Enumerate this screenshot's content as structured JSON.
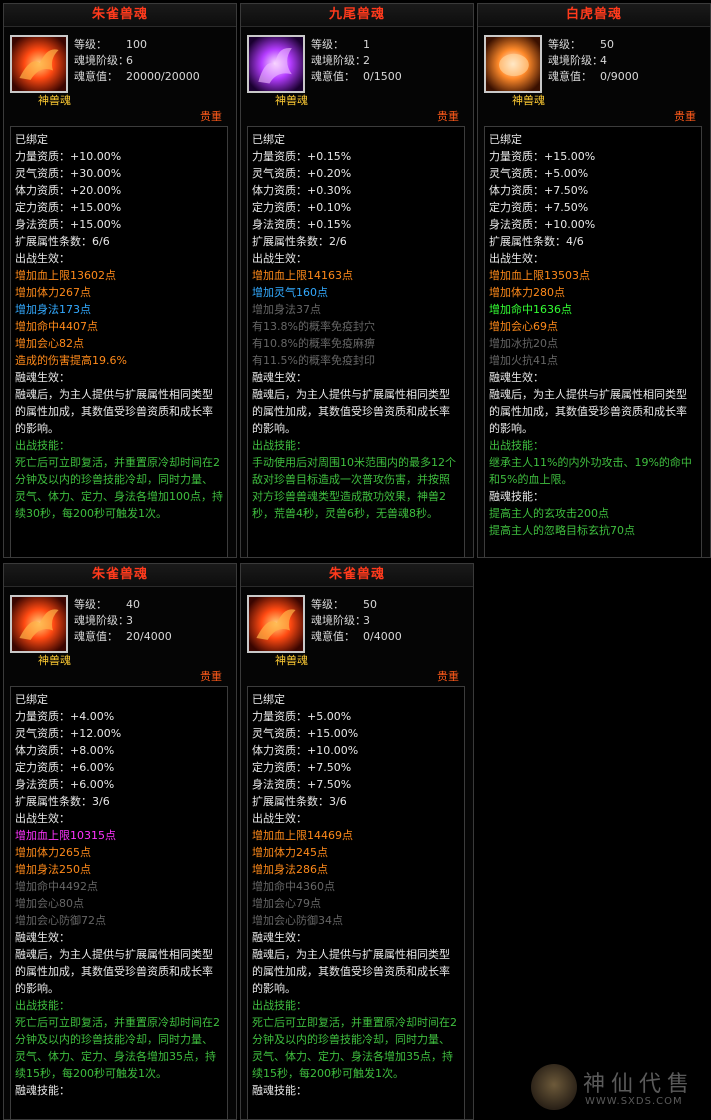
{
  "panels": [
    {
      "id": "p1",
      "title": "朱雀兽魂",
      "icon": "zhuque-icon",
      "stats": {
        "level_label": "等级：",
        "level": "100",
        "realm_label": "魂境阶级：",
        "realm": "6",
        "will_label": "魂意值：",
        "will": "20000/20000"
      },
      "kind": "神兽魂",
      "rarity": "贵重",
      "lines": [
        {
          "t": "已绑定",
          "c": "white"
        },
        {
          "t": "力量资质：+10.00%",
          "c": "white"
        },
        {
          "t": "灵气资质：+30.00%",
          "c": "white"
        },
        {
          "t": "体力资质：+20.00%",
          "c": "white"
        },
        {
          "t": "定力资质：+15.00%",
          "c": "white"
        },
        {
          "t": "身法资质：+15.00%",
          "c": "white"
        },
        {
          "t": "扩展属性条数：6/6",
          "c": "white"
        },
        {
          "t": "出战生效：",
          "c": "white"
        },
        {
          "t": "增加血上限13602点",
          "c": "orange"
        },
        {
          "t": "增加体力267点",
          "c": "orange"
        },
        {
          "t": "增加身法173点",
          "c": "blue"
        },
        {
          "t": "增加命中4407点",
          "c": "orange"
        },
        {
          "t": "增加会心82点",
          "c": "orange"
        },
        {
          "t": "造成的伤害提高19.6%",
          "c": "orange"
        },
        {
          "t": "融魂生效：",
          "c": "white"
        },
        {
          "t": "融魂后，为主人提供与扩展属性相同类型的属性加成，其数值受珍兽资质和成长率的影响。",
          "c": "white",
          "wrap": true
        },
        {
          "t": "出战技能：",
          "c": "darkgreen"
        },
        {
          "t": "死亡后可立即复活，并重置原冷却时间在2分钟及以内的珍兽技能冷却，同时力量、灵气、体力、定力、身法各增加100点，持续30秒，每200秒可触发1次。",
          "c": "darkgreen",
          "wrap": true
        }
      ]
    },
    {
      "id": "p2",
      "title": "九尾兽魂",
      "icon": "jiuwei-icon",
      "stats": {
        "level_label": "等级：",
        "level": "1",
        "realm_label": "魂境阶级：",
        "realm": "2",
        "will_label": "魂意值：",
        "will": "0/1500"
      },
      "kind": "神兽魂",
      "rarity": "贵重",
      "lines": [
        {
          "t": "已绑定",
          "c": "white"
        },
        {
          "t": "力量资质：+0.15%",
          "c": "white"
        },
        {
          "t": "灵气资质：+0.20%",
          "c": "white"
        },
        {
          "t": "体力资质：+0.30%",
          "c": "white"
        },
        {
          "t": "定力资质：+0.10%",
          "c": "white"
        },
        {
          "t": "身法资质：+0.15%",
          "c": "white"
        },
        {
          "t": "扩展属性条数：2/6",
          "c": "white"
        },
        {
          "t": "出战生效：",
          "c": "white"
        },
        {
          "t": "增加血上限14163点",
          "c": "orange"
        },
        {
          "t": "增加灵气160点",
          "c": "blue"
        },
        {
          "t": "增加身法37点",
          "c": "gray"
        },
        {
          "t": "有13.8%的概率免疫封穴",
          "c": "gray"
        },
        {
          "t": "有10.8%的概率免疫麻痹",
          "c": "gray"
        },
        {
          "t": "有11.5%的概率免疫封印",
          "c": "gray"
        },
        {
          "t": "融魂生效：",
          "c": "white"
        },
        {
          "t": "融魂后，为主人提供与扩展属性相同类型的属性加成，其数值受珍兽资质和成长率的影响。",
          "c": "white",
          "wrap": true
        },
        {
          "t": "出战技能：",
          "c": "darkgreen"
        },
        {
          "t": "手动使用后对周围10米范围内的最多12个敌对珍兽目标造成一次普攻伤害，并按照对方珍兽兽魂类型造成散功效果，神兽2秒，荒兽4秒，灵兽6秒，无兽魂8秒。",
          "c": "darkgreen",
          "wrap": true
        }
      ]
    },
    {
      "id": "p3",
      "title": "白虎兽魂",
      "icon": "baihu-icon",
      "stats": {
        "level_label": "等级：",
        "level": "50",
        "realm_label": "魂境阶级：",
        "realm": "4",
        "will_label": "魂意值：",
        "will": "0/9000"
      },
      "kind": "神兽魂",
      "rarity": "贵重",
      "lines": [
        {
          "t": "已绑定",
          "c": "white"
        },
        {
          "t": "力量资质：+15.00%",
          "c": "white"
        },
        {
          "t": "灵气资质：+5.00%",
          "c": "white"
        },
        {
          "t": "体力资质：+7.50%",
          "c": "white"
        },
        {
          "t": "定力资质：+7.50%",
          "c": "white"
        },
        {
          "t": "身法资质：+10.00%",
          "c": "white"
        },
        {
          "t": "扩展属性条数：4/6",
          "c": "white"
        },
        {
          "t": "出战生效：",
          "c": "white"
        },
        {
          "t": "增加血上限13503点",
          "c": "orange"
        },
        {
          "t": "增加体力280点",
          "c": "orange"
        },
        {
          "t": "增加命中1636点",
          "c": "green"
        },
        {
          "t": "增加会心69点",
          "c": "orange"
        },
        {
          "t": "增加冰抗20点",
          "c": "gray"
        },
        {
          "t": "增加火抗41点",
          "c": "gray"
        },
        {
          "t": "融魂生效：",
          "c": "white"
        },
        {
          "t": "融魂后，为主人提供与扩展属性相同类型的属性加成，其数值受珍兽资质和成长率的影响。",
          "c": "white",
          "wrap": true
        },
        {
          "t": "出战技能：",
          "c": "darkgreen"
        },
        {
          "t": "继承主人11%的内外功攻击、19%的命中和5%的血上限。",
          "c": "darkgreen",
          "wrap": true
        },
        {
          "t": "融魂技能：",
          "c": "white"
        },
        {
          "t": "提高主人的玄攻击200点",
          "c": "darkgreen"
        },
        {
          "t": "提高主人的忽略目标玄抗70点",
          "c": "darkgreen"
        }
      ]
    },
    {
      "id": "p4",
      "title": "朱雀兽魂",
      "icon": "zhuque-icon",
      "stats": {
        "level_label": "等级：",
        "level": "40",
        "realm_label": "魂境阶级：",
        "realm": "3",
        "will_label": "魂意值：",
        "will": "20/4000"
      },
      "kind": "神兽魂",
      "rarity": "贵重",
      "lines": [
        {
          "t": "已绑定",
          "c": "white"
        },
        {
          "t": "力量资质：+4.00%",
          "c": "white"
        },
        {
          "t": "灵气资质：+12.00%",
          "c": "white"
        },
        {
          "t": "体力资质：+8.00%",
          "c": "white"
        },
        {
          "t": "定力资质：+6.00%",
          "c": "white"
        },
        {
          "t": "身法资质：+6.00%",
          "c": "white"
        },
        {
          "t": "扩展属性条数：3/6",
          "c": "white"
        },
        {
          "t": "出战生效：",
          "c": "white"
        },
        {
          "t": "增加血上限10315点",
          "c": "magenta"
        },
        {
          "t": "增加体力265点",
          "c": "orange"
        },
        {
          "t": "增加身法250点",
          "c": "orange"
        },
        {
          "t": "增加命中4492点",
          "c": "gray"
        },
        {
          "t": "增加会心80点",
          "c": "gray"
        },
        {
          "t": "增加会心防御72点",
          "c": "gray"
        },
        {
          "t": "融魂生效：",
          "c": "white"
        },
        {
          "t": "融魂后，为主人提供与扩展属性相同类型的属性加成，其数值受珍兽资质和成长率的影响。",
          "c": "white",
          "wrap": true
        },
        {
          "t": "出战技能：",
          "c": "darkgreen"
        },
        {
          "t": "死亡后可立即复活，并重置原冷却时间在2分钟及以内的珍兽技能冷却，同时力量、灵气、体力、定力、身法各增加35点，持续15秒，每200秒可触发1次。",
          "c": "darkgreen",
          "wrap": true
        },
        {
          "t": "融魂技能：",
          "c": "white"
        }
      ]
    },
    {
      "id": "p5",
      "title": "朱雀兽魂",
      "icon": "zhuque-icon",
      "stats": {
        "level_label": "等级：",
        "level": "50",
        "realm_label": "魂境阶级：",
        "realm": "3",
        "will_label": "魂意值：",
        "will": "0/4000"
      },
      "kind": "神兽魂",
      "rarity": "贵重",
      "lines": [
        {
          "t": "已绑定",
          "c": "white"
        },
        {
          "t": "力量资质：+5.00%",
          "c": "white"
        },
        {
          "t": "灵气资质：+15.00%",
          "c": "white"
        },
        {
          "t": "体力资质：+10.00%",
          "c": "white"
        },
        {
          "t": "定力资质：+7.50%",
          "c": "white"
        },
        {
          "t": "身法资质：+7.50%",
          "c": "white"
        },
        {
          "t": "扩展属性条数：3/6",
          "c": "white"
        },
        {
          "t": "出战生效：",
          "c": "white"
        },
        {
          "t": "增加血上限14469点",
          "c": "orange"
        },
        {
          "t": "增加体力245点",
          "c": "orange"
        },
        {
          "t": "增加身法286点",
          "c": "orange"
        },
        {
          "t": "增加命中4360点",
          "c": "gray"
        },
        {
          "t": "增加会心79点",
          "c": "gray"
        },
        {
          "t": "增加会心防御34点",
          "c": "gray"
        },
        {
          "t": "融魂生效：",
          "c": "white"
        },
        {
          "t": "融魂后，为主人提供与扩展属性相同类型的属性加成，其数值受珍兽资质和成长率的影响。",
          "c": "white",
          "wrap": true
        },
        {
          "t": "出战技能：",
          "c": "darkgreen"
        },
        {
          "t": "死亡后可立即复活，并重置原冷却时间在2分钟及以内的珍兽技能冷却，同时力量、灵气、体力、定力、身法各增加35点，持续15秒，每200秒可触发1次。",
          "c": "darkgreen",
          "wrap": true
        },
        {
          "t": "融魂技能：",
          "c": "white"
        }
      ]
    }
  ],
  "watermark": {
    "text": "神仙代售",
    "url": "WWW.SXDS.COM"
  },
  "colors": {
    "title": "#ff3a1c",
    "orange": "#ff8a1a",
    "blue": "#33aaff",
    "magenta": "#ff33ff",
    "green": "#33ff33",
    "darkgreen": "#3fbf3f",
    "gray": "#666666"
  }
}
